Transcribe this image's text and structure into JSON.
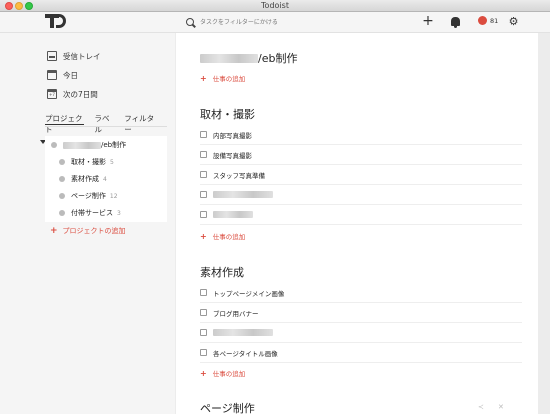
{
  "window": {
    "title": "Todoist"
  },
  "header": {
    "search_placeholder": "タスクをフィルターにかける",
    "karma": "81"
  },
  "sidebar": {
    "nav": [
      {
        "label": "受信トレイ",
        "icon": "inbox-icon"
      },
      {
        "label": "今日",
        "icon": "calendar-icon"
      },
      {
        "label": "次の7日間",
        "icon": "calendar-week-icon"
      }
    ],
    "tabs": [
      "プロジェクト",
      "ラベル",
      "フィルター"
    ],
    "projects": [
      {
        "name": "/eb制作",
        "count": ""
      },
      {
        "name": "取材・撮影",
        "count": "5"
      },
      {
        "name": "素材作成",
        "count": "4"
      },
      {
        "name": "ページ制作",
        "count": "12"
      },
      {
        "name": "付帯サービス",
        "count": "3"
      }
    ],
    "add_project": "プロジェクトの追加"
  },
  "main": {
    "sections": [
      {
        "title": "/eb制作",
        "add_task": "仕事の追加"
      },
      {
        "title": "取材・撮影",
        "tasks": [
          "内部写真撮影",
          "設備写真撮影",
          "スタッフ写真準備",
          "",
          ""
        ],
        "add_task": "仕事の追加"
      },
      {
        "title": "素材作成",
        "tasks": [
          "トップページメイン画像",
          "ブログ用バナー",
          "",
          "各ページタイトル画像"
        ],
        "add_task": "仕事の追加"
      },
      {
        "title": "ページ制作"
      }
    ]
  },
  "colors": {
    "accent": "#db4c3f",
    "karma": "#db4c3f"
  }
}
